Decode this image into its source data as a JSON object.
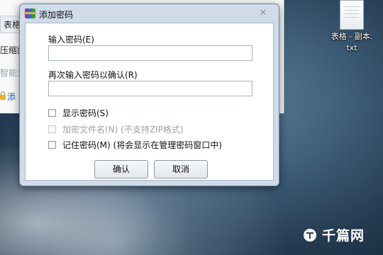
{
  "background_window": {
    "items": [
      {
        "label": "表格"
      },
      {
        "label": "压缩面"
      },
      {
        "label": "智能无"
      },
      {
        "label": "添"
      }
    ]
  },
  "desktop": {
    "file_label_line1": "表格 - 副本.",
    "file_label_line2": "txt",
    "file_icon": "text-file-icon"
  },
  "watermark": {
    "text": "千篇网"
  },
  "dialog": {
    "title": "添加密码",
    "close_symbol": "✕",
    "password_label": "输入密码(E)",
    "password_value": "",
    "confirm_label": "再次输入密码以确认(R)",
    "confirm_value": "",
    "checkboxes": [
      {
        "label": "显示密码(S)",
        "checked": false,
        "enabled": true
      },
      {
        "label": "加密文件名(N) (不支持ZIP格式)",
        "checked": false,
        "enabled": false
      },
      {
        "label": "记住密码(M) (将会显示在管理密码窗口中)",
        "checked": false,
        "enabled": true
      }
    ],
    "ok_label": "确认",
    "cancel_label": "取消"
  }
}
